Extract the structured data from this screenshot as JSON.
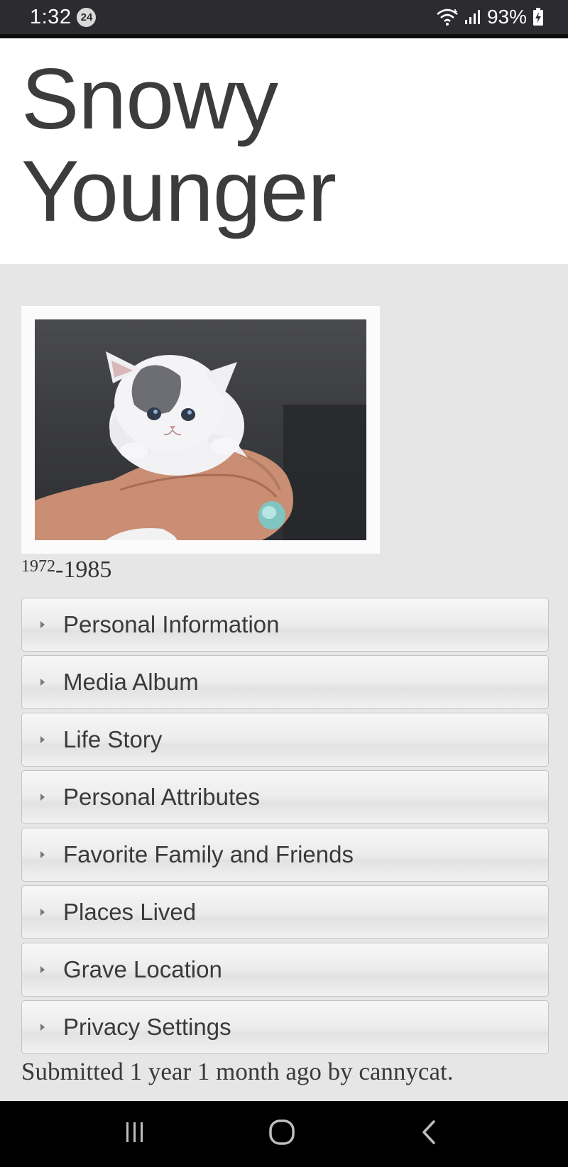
{
  "status_bar": {
    "time": "1:32",
    "notification_count": "24",
    "battery": "93%",
    "icons": [
      "wifi-icon",
      "signal-icon",
      "battery-charging-icon"
    ]
  },
  "header": {
    "title_line1": "Snowy",
    "title_line2": "Younger"
  },
  "profile": {
    "photo_icon": "kitten-photo",
    "birth_year": "1972",
    "dash": "-",
    "death_year": "1985"
  },
  "sections": [
    {
      "label": "Personal Information"
    },
    {
      "label": "Media Album"
    },
    {
      "label": "Life Story"
    },
    {
      "label": "Personal Attributes"
    },
    {
      "label": "Favorite Family and Friends"
    },
    {
      "label": "Places Lived"
    },
    {
      "label": "Grave Location"
    },
    {
      "label": "Privacy Settings"
    }
  ],
  "footer": {
    "submitted_text": "Submitted 1 year 1 month ago by cannycat."
  },
  "nav_bar": {
    "icons": [
      "recent-apps-icon",
      "home-icon",
      "back-icon"
    ]
  },
  "colors": {
    "status_bar_bg": "#2c2c30",
    "page_bg": "#e6e6e6",
    "title_text": "#3c3c3c",
    "nav_bar_bg": "#000000"
  }
}
